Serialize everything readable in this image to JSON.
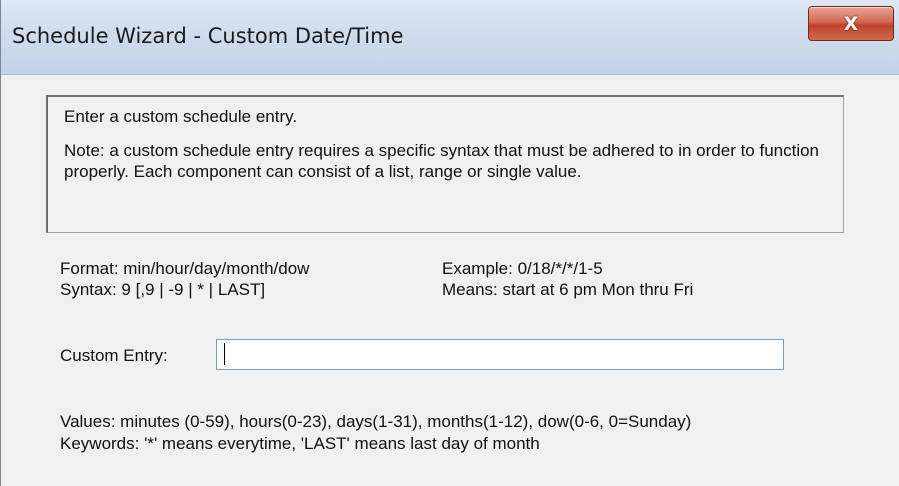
{
  "window": {
    "title": "Schedule Wizard - Custom Date/Time",
    "close_label": "X"
  },
  "info": {
    "intro": "Enter a custom schedule entry.",
    "note": "Note: a custom schedule entry requires a specific syntax that must be adhered to in order to function properly. Each component can consist of a list, range or single value."
  },
  "format": {
    "format_line": "Format: min/hour/day/month/dow",
    "syntax_line": "Syntax: 9 [,9 | -9 | * | LAST]",
    "example_line": "Example: 0/18/*/*/1-5",
    "means_line": "Means: start at 6 pm Mon thru Fri"
  },
  "custom_entry": {
    "label": "Custom Entry:",
    "value": "",
    "placeholder": ""
  },
  "help": {
    "values_line": "Values: minutes (0-59), hours(0-23), days(1-31), months(1-12), dow(0-6, 0=Sunday)",
    "keywords_line": "Keywords: '*' means everytime, 'LAST' means last day of month"
  }
}
